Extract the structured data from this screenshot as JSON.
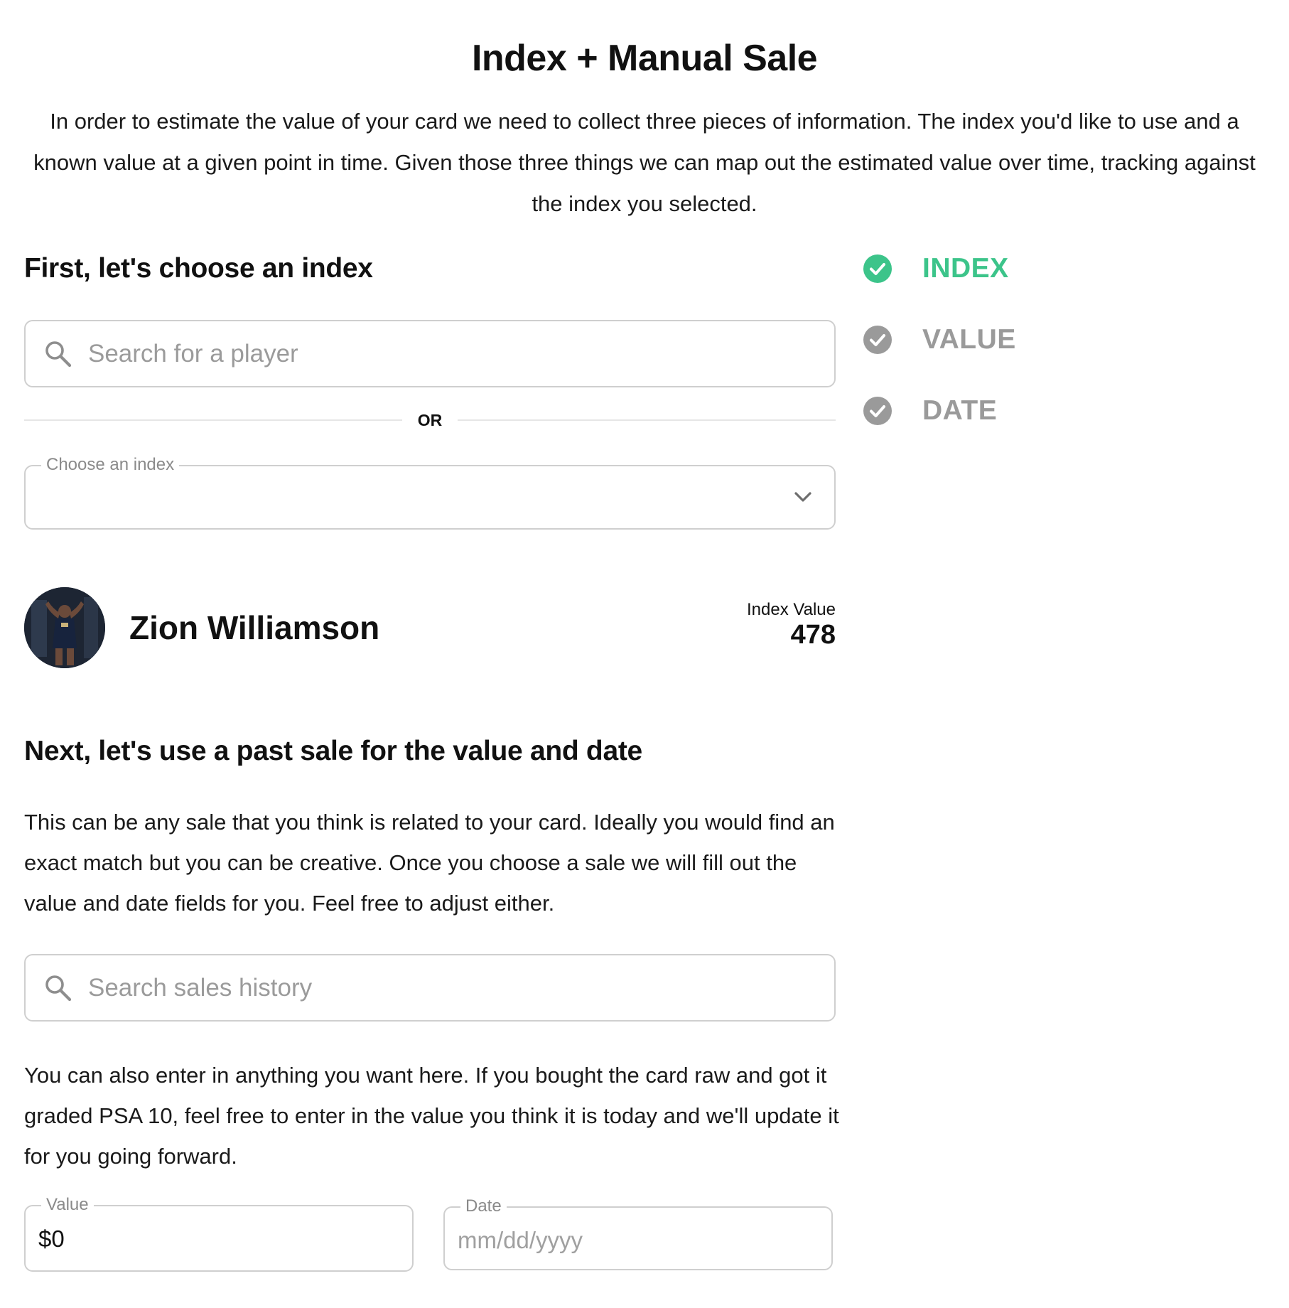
{
  "header": {
    "title": "Index + Manual Sale",
    "intro": "In order to estimate the value of your card we need to collect three pieces of information. The index you'd like to use and a known value at a given point in time. Given those three things we can map out the estimated value over time, tracking against the index you selected."
  },
  "index_section": {
    "heading": "First, let's choose an index",
    "search_placeholder": "Search for a player",
    "or_label": "OR",
    "select_legend": "Choose an index",
    "select_value": ""
  },
  "player": {
    "name": "Zion Williamson",
    "index_value_label": "Index Value",
    "index_value": "478"
  },
  "sale_section": {
    "heading": "Next, let's use a past sale for the value and date",
    "description": "This can be any sale that you think is related to your card. Ideally you would find an exact match but you can be creative. Once you choose a sale we will fill out the value and date fields for you. Feel free to adjust either.",
    "search_placeholder": "Search sales history",
    "manual_text": "You can also enter in anything you want here. If you bought the card raw and got it graded PSA 10, feel free to enter in the value you think it is today and we'll update it for you going forward.",
    "value_legend": "Value",
    "value_input": "$0",
    "date_legend": "Date",
    "date_placeholder": "mm/dd/yyyy"
  },
  "steps": [
    {
      "label": "INDEX",
      "status": "complete",
      "color": "#3cc48a",
      "icon": "check-circle-icon"
    },
    {
      "label": "VALUE",
      "status": "pending",
      "color": "#9a9a9a",
      "icon": "check-circle-icon"
    },
    {
      "label": "DATE",
      "status": "pending",
      "color": "#9a9a9a",
      "icon": "check-circle-icon"
    }
  ]
}
